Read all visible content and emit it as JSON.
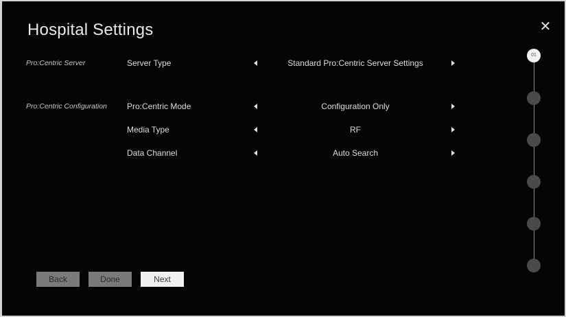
{
  "header": {
    "title": "Hospital Settings",
    "close_glyph": "✕"
  },
  "rows": [
    {
      "section": "Pro:Centric Server",
      "name": "Server Type",
      "value": "Standard Pro:Centric Server Settings"
    },
    {
      "section": "Pro:Centric Configuration",
      "name": "Pro:Centric Mode",
      "value": "Configuration Only"
    },
    {
      "section": "",
      "name": "Media Type",
      "value": "RF"
    },
    {
      "section": "",
      "name": "Data Channel",
      "value": "Auto Search"
    }
  ],
  "buttons": {
    "back": "Back",
    "done": "Done",
    "next": "Next"
  },
  "steps": {
    "current_label": "01"
  },
  "icons": {
    "close": "close-icon",
    "left_arrow": "arrow-left-icon",
    "right_arrow": "arrow-right-icon"
  },
  "colors": {
    "background": "#050505",
    "text": "#dcdcdc",
    "button_dim": "#7a7a7a",
    "button_active": "#f0f0f0",
    "step_inactive": "#4a4a4a",
    "step_active": "#f2f2f2"
  }
}
